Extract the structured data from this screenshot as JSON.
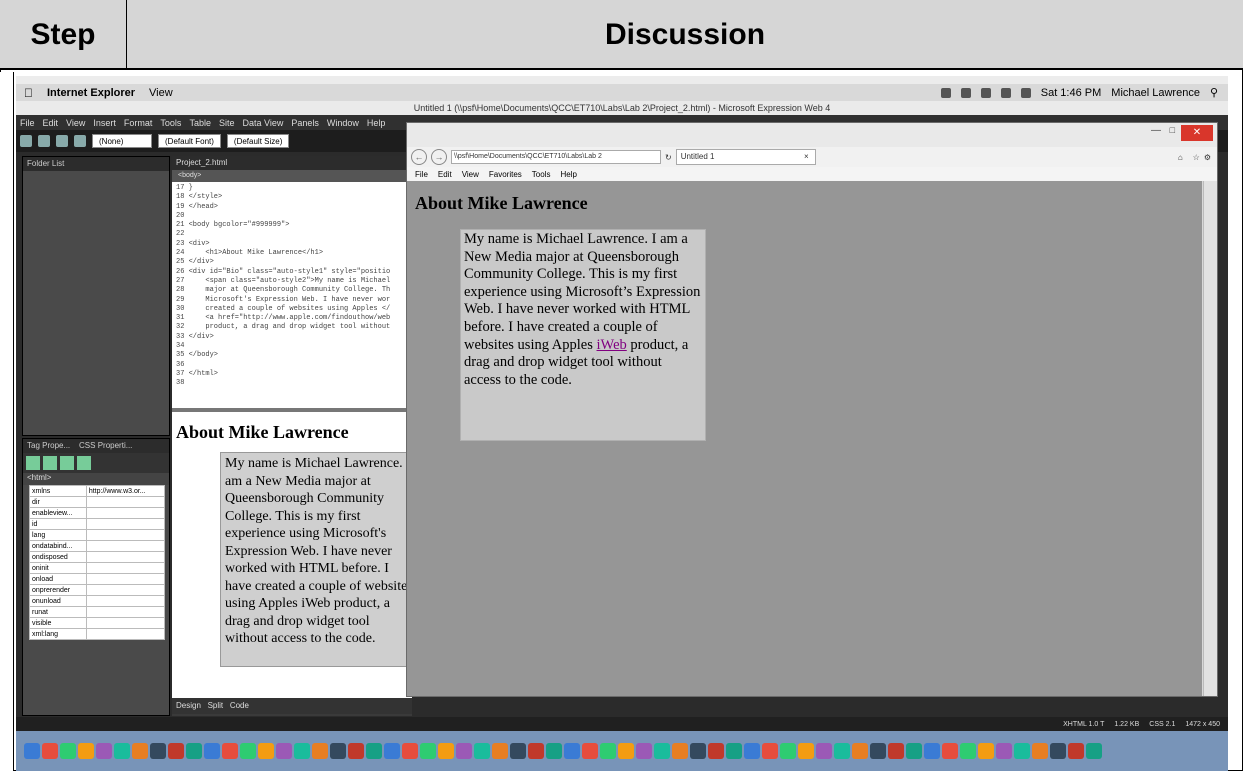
{
  "table_header": {
    "step": "Step",
    "discussion": "Discussion"
  },
  "menubar": {
    "app_name": "Internet Explorer",
    "menu_view": "View",
    "clock": "Sat 1:46 PM",
    "user": "Michael Lawrence"
  },
  "expression_web": {
    "window_title": "Untitled 1 (\\\\psf\\Home\\Documents\\QCC\\ET710\\Labs\\Lab 2\\Project_2.html) - Microsoft Expression Web 4",
    "menu": [
      "File",
      "Edit",
      "View",
      "Insert",
      "Format",
      "Tools",
      "Table",
      "Site",
      "Data View",
      "Panels",
      "Window",
      "Help"
    ],
    "style_combo": "(None)",
    "font_combo": "(Default Font)",
    "size_combo": "(Default Size)",
    "folder_panel_title": "Folder List",
    "tag_panel_title": "Tag Prope...",
    "css_panel_title": "CSS Properti...",
    "tag_path": "<html>",
    "properties": [
      {
        "name": "xmlns",
        "value": "http://www.w3.or..."
      },
      {
        "name": "dir",
        "value": ""
      },
      {
        "name": "enableview...",
        "value": ""
      },
      {
        "name": "id",
        "value": ""
      },
      {
        "name": "lang",
        "value": ""
      },
      {
        "name": "ondatabind...",
        "value": ""
      },
      {
        "name": "ondisposed",
        "value": ""
      },
      {
        "name": "oninit",
        "value": ""
      },
      {
        "name": "onload",
        "value": ""
      },
      {
        "name": "onprerender",
        "value": ""
      },
      {
        "name": "onunload",
        "value": ""
      },
      {
        "name": "runat",
        "value": ""
      },
      {
        "name": "visible",
        "value": ""
      },
      {
        "name": "xml:lang",
        "value": ""
      }
    ],
    "editor_tab": "Project_2.html",
    "editor_path": "<body>",
    "code_lines": [
      "17 }",
      "18 </style>",
      "19 </head>",
      "20",
      "21 <body bgcolor=\"#999999\">",
      "22",
      "23 <div>",
      "24     <h1>About Mike Lawrence</h1>",
      "25 </div>",
      "26 <div id=\"Bio\" class=\"auto-style1\" style=\"positio",
      "27     <span class=\"auto-style2\">My name is Michael",
      "28     major at Queensborough Community College. Th",
      "29     Microsoft's Expression Web. I have never wor",
      "30     created a couple of websites using Apples </",
      "31     <a href=\"http://www.apple.com/findouthow/web",
      "32     product, a drag and drop widget tool without",
      "33 </div>",
      "34",
      "35 </body>",
      "36",
      "37 </html>",
      "38"
    ],
    "design_heading": "About Mike Lawrence",
    "design_text": "My name is Michael Lawrence. I am a New Media major at Queensborough Community College. This is my first experience using Microsoft's Expression Web. I have never worked with HTML before. I have created a couple of websites using Apples iWeb product, a drag and drop widget tool without access to the code.",
    "view_tabs": [
      "Design",
      "Split",
      "Code"
    ],
    "status_doctype": "XHTML 1.0 T",
    "status_size": "1.22 KB",
    "status_css": "CSS 2.1",
    "status_dims": "1472 x 450"
  },
  "ie_window": {
    "address": "\\\\psf\\Home\\Documents\\QCC\\ET710\\Labs\\Lab 2",
    "tab_title": "Untitled 1",
    "menu": [
      "File",
      "Edit",
      "View",
      "Favorites",
      "Tools",
      "Help"
    ],
    "heading": "About Mike Lawrence",
    "bio_before_link": "My name is Michael Lawrence. I am a New Media major at Queensborough Community College. This is my first experience using Microsoft’s Expression Web. I have never worked with HTML before. I have created a couple of websites using Apples ",
    "bio_link": "iWeb",
    "bio_after_link": " product, a drag and drop widget tool without access to the code."
  }
}
